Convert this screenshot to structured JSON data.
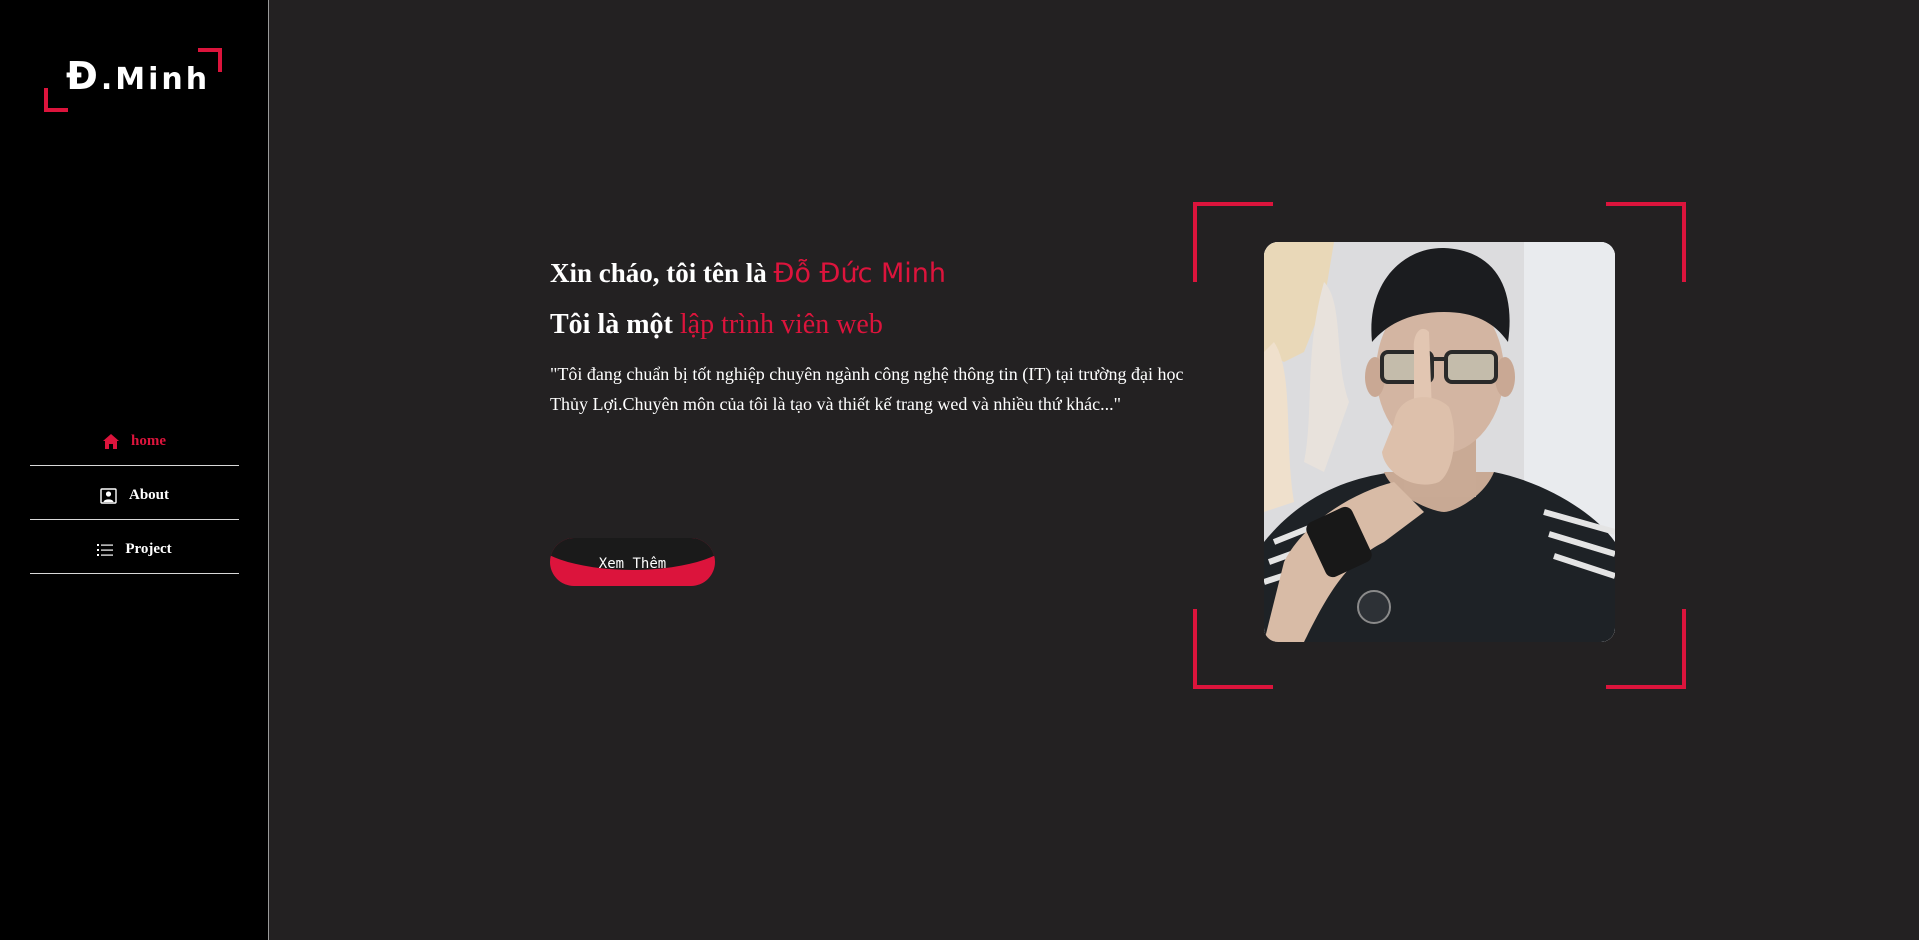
{
  "logo": {
    "initial": "Đ",
    "rest": ".Minh"
  },
  "nav": {
    "items": [
      {
        "label": "home",
        "icon": "home-icon",
        "active": true
      },
      {
        "label": "About",
        "icon": "user-icon",
        "active": false
      },
      {
        "label": "Project",
        "icon": "list-icon",
        "active": false
      }
    ]
  },
  "hero": {
    "greeting_prefix": "Xin cháo, tôi tên là",
    "name": "Đỗ Đức Minh",
    "role_prefix": "Tôi là một",
    "role": "lập trình viên web",
    "intro": "\"Tôi đang chuẩn bị tốt nghiệp chuyên ngành công nghệ thông tin (IT) tại trường đại học Thủy Lợi.Chuyên môn của tôi là tạo và thiết kế trang wed và nhiều thứ khác...\"",
    "button_label": "Xem Thêm"
  },
  "colors": {
    "accent": "#dc143c",
    "sidebar_bg": "#000000",
    "main_bg": "#232122"
  }
}
